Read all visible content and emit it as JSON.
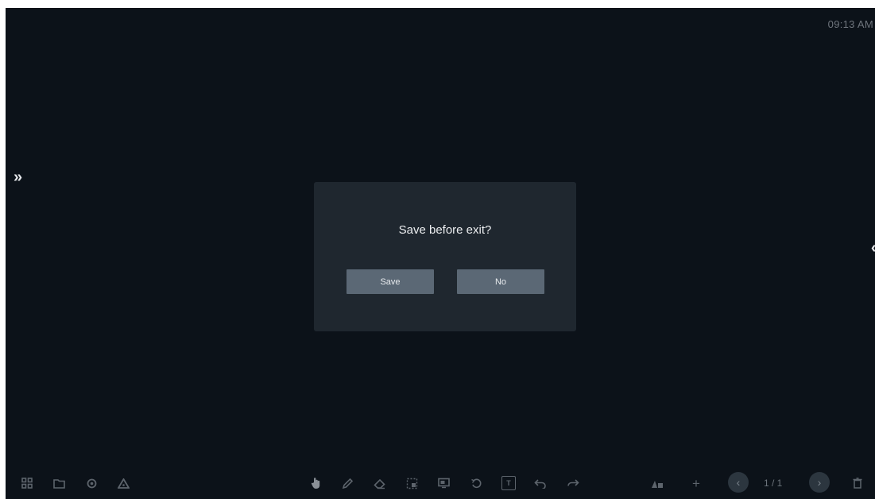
{
  "clock": "09:13 AM",
  "sidebar": {
    "left_toggle_glyph": "»",
    "right_toggle_glyph": "«"
  },
  "dialog": {
    "title": "Save before exit?",
    "save_label": "Save",
    "no_label": "No"
  },
  "toolbar_left": {
    "icons": [
      "apps-icon",
      "folder-icon",
      "settings-icon",
      "triangle-icon"
    ]
  },
  "toolbar_center": {
    "icons": [
      "hand-select-icon",
      "pen-icon",
      "eraser-icon",
      "select-region-icon",
      "screenshot-icon",
      "undo-circle-icon",
      "text-box-icon",
      "undo-icon",
      "redo-icon"
    ],
    "text_box_glyph": "T"
  },
  "toolbar_right": {
    "icons": [
      "tools-icon",
      "add-page-icon",
      "prev-page-icon",
      "next-page-icon",
      "delete-page-icon"
    ],
    "page_indicator": "1 / 1"
  },
  "colors": {
    "background": "#0c1219",
    "dialog": "#1f272f",
    "button": "#5b6875",
    "toolbar_icon": "#5d646c"
  }
}
